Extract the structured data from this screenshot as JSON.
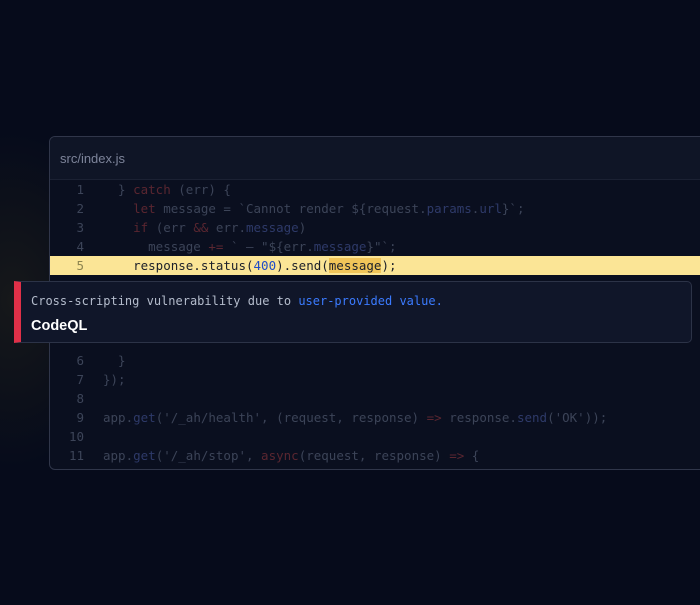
{
  "file": {
    "name": "src/index.js"
  },
  "code_lines": [
    {
      "num": "1",
      "parts": [
        [
          "  } ",
          ""
        ],
        [
          "catch",
          "kw"
        ],
        [
          " (err) {",
          ""
        ]
      ]
    },
    {
      "num": "2",
      "parts": [
        [
          "    ",
          ""
        ],
        [
          "let",
          "kw"
        ],
        [
          " message = `Cannot render ${request.",
          ""
        ],
        [
          "params",
          "fn"
        ],
        [
          ".",
          ""
        ],
        [
          "url",
          "fn"
        ],
        [
          "}`;",
          ""
        ]
      ]
    },
    {
      "num": "3",
      "parts": [
        [
          "    ",
          ""
        ],
        [
          "if",
          "kw"
        ],
        [
          " (err ",
          ""
        ],
        [
          "&&",
          "kw"
        ],
        [
          " err.",
          ""
        ],
        [
          "message",
          "fn"
        ],
        [
          ")",
          ""
        ]
      ]
    },
    {
      "num": "4",
      "parts": [
        [
          "      message ",
          ""
        ],
        [
          "+=",
          "kw"
        ],
        [
          " ` — \"${err.",
          ""
        ],
        [
          "message",
          "fn"
        ],
        [
          "}\"`;",
          ""
        ]
      ]
    },
    {
      "num": "5",
      "highlight": true,
      "parts": [
        [
          "    response.status(",
          ""
        ],
        [
          "400",
          "n"
        ],
        [
          ").send(",
          ""
        ],
        [
          "message",
          "arg"
        ],
        [
          ");",
          ""
        ]
      ]
    },
    {
      "num": "6",
      "parts": [
        [
          "  }",
          ""
        ]
      ]
    },
    {
      "num": "7",
      "parts": [
        [
          "});",
          ""
        ]
      ]
    },
    {
      "num": "8",
      "parts": [
        [
          "",
          ""
        ]
      ]
    },
    {
      "num": "9",
      "parts": [
        [
          "app.",
          ""
        ],
        [
          "get",
          "fn"
        ],
        [
          "('/_ah/health', (request, response) ",
          ""
        ],
        [
          "=>",
          "kw"
        ],
        [
          " response.",
          ""
        ],
        [
          "send",
          "fn"
        ],
        [
          "('OK'));",
          ""
        ]
      ]
    },
    {
      "num": "10",
      "parts": [
        [
          "",
          ""
        ]
      ]
    },
    {
      "num": "11",
      "parts": [
        [
          "app.",
          ""
        ],
        [
          "get",
          "fn"
        ],
        [
          "('/_ah/stop', ",
          ""
        ],
        [
          "async",
          "kw"
        ],
        [
          "(request, response) ",
          ""
        ],
        [
          "=>",
          "kw"
        ],
        [
          " {",
          ""
        ]
      ]
    }
  ],
  "alert": {
    "message_text": "Cross-scripting vulnerability due to ",
    "message_link": "user-provided value.",
    "title": "CodeQL"
  },
  "colors": {
    "alert_accent": "#e03048",
    "highlight_line": "#fbe596",
    "link": "#3b7bff"
  }
}
